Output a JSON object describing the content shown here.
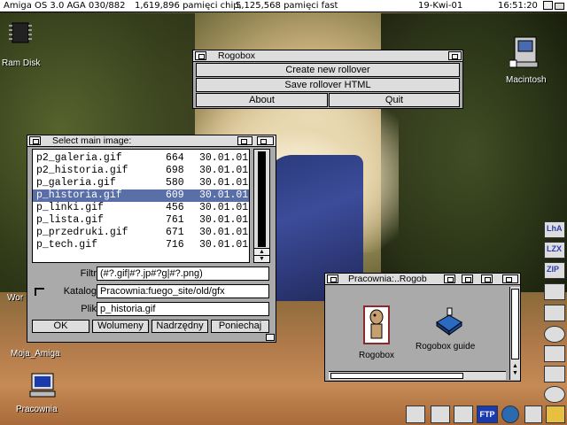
{
  "screen": {
    "title": "Amiga OS 3.0 AGA 030/882",
    "chip": "1,619,896 pamięci chip,",
    "fast": "5,125,568 pamięci fast",
    "date": "19-Kwi-01",
    "time": "16:51:20"
  },
  "desktop": {
    "ram_disk": "Ram Disk",
    "macintosh": "Macintosh",
    "work": "Wor",
    "moja_amiga": "Moja_Amiga",
    "pracownia": "Pracownia"
  },
  "rogobox": {
    "title": "Rogobox",
    "create": "Create new rollover",
    "save": "Save rollover HTML",
    "about": "About",
    "quit": "Quit"
  },
  "requester": {
    "title": "Select main image:",
    "files": [
      {
        "name": "p2_galeria.gif",
        "size": "664",
        "date": "30.01.01"
      },
      {
        "name": "p2_historia.gif",
        "size": "698",
        "date": "30.01.01"
      },
      {
        "name": "p_galeria.gif",
        "size": "580",
        "date": "30.01.01"
      },
      {
        "name": "p_historia.gif",
        "size": "609",
        "date": "30.01.01"
      },
      {
        "name": "p_linki.gif",
        "size": "456",
        "date": "30.01.01"
      },
      {
        "name": "p_lista.gif",
        "size": "761",
        "date": "30.01.01"
      },
      {
        "name": "p_przedruki.gif",
        "size": "671",
        "date": "30.01.01"
      },
      {
        "name": "p_tech.gif",
        "size": "716",
        "date": "30.01.01"
      }
    ],
    "selected_index": 3,
    "filtr_label": "Filtr",
    "filtr_value": "(#?.gif|#?.jp#?g|#?.png)",
    "katalog_label": "Katalog",
    "katalog_value": "Pracownia:fuego_site/old/gfx",
    "plik_label": "Plik",
    "plik_value": "p_historia.gif",
    "ok": "OK",
    "wolumeny": "Wolumeny",
    "nadrzedny": "Nadrzędny",
    "poniechaj": "Poniechaj"
  },
  "drawer": {
    "title": "Pracownia:..Rogob",
    "icon1": "Rogobox",
    "icon2": "Rogobox guide"
  },
  "dock": {
    "lha": "LhA",
    "lzx": "LZX",
    "zip": "ZIP",
    "ftp": "FTP"
  },
  "colors": {
    "selection": "#5a6ea8",
    "window_bg": "#aaaaaa",
    "titlebar": "#dddddd"
  }
}
